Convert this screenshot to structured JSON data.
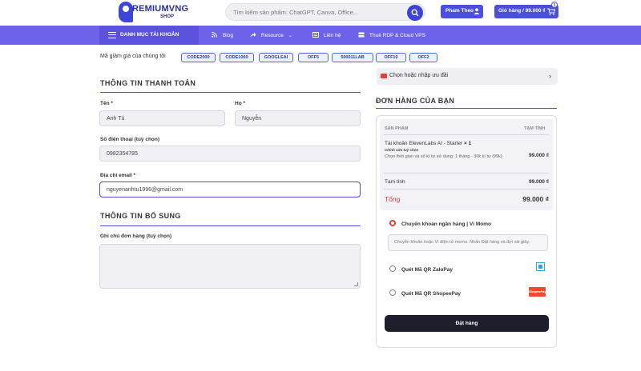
{
  "header": {
    "logo_main": "REMIUMVNG",
    "logo_sub": "SHOP",
    "search_placeholder": "Tìm kiếm sản phẩm: ChatGPT, Canva, Office...",
    "user_label": "Pham Theo",
    "cart_label": "Giỏ hàng / 99.000 ₫",
    "cart_count": "1",
    "accent": "#4b4fe0"
  },
  "nav": {
    "category_label": "DANH MỤC TÀI KHOẢN",
    "items": [
      {
        "label": "Blog",
        "icon": "rss-icon"
      },
      {
        "label": "Resource",
        "icon": "share-icon"
      },
      {
        "label": "Liên hệ",
        "icon": "contact-icon"
      },
      {
        "label": "Thuê RDP & Cloud VPS",
        "icon": "server-icon"
      }
    ]
  },
  "coupons": {
    "label": "Mã giảm giá của chúng tôi",
    "codes": [
      "CODE2000",
      "CODE1000",
      "GOOGLEAI",
      "OFF5",
      "500011LAB",
      "OFF10",
      "OFF2"
    ]
  },
  "billing": {
    "title": "THÔNG TIN THANH TOÁN",
    "first_name_label": "Tên *",
    "first_name_value": "Anh Tú",
    "last_name_label": "Họ *",
    "last_name_value": "Nguyễn",
    "phone_label": "Số điện thoại (tuỳ chọn)",
    "phone_value": "0982354785",
    "email_label": "Địa chỉ email *",
    "email_value": "nguyenanhtu1996@gmail.com"
  },
  "additional": {
    "title": "THÔNG TIN BỔ SUNG",
    "notes_label": "Ghi chú đơn hàng (tuỳ chọn)"
  },
  "order": {
    "promo_label": "Chọn hoặc nhập ưu đãi",
    "title": "ĐƠN HÀNG CỦA BẠN",
    "col_product": "SẢN PHẨM",
    "col_subtotal": "TẠM TÍNH",
    "product_name": "Tài khoản ElevenLabs AI - Starter",
    "product_qty": "× 1",
    "product_sub": "Chính sửa tuỳ chọn",
    "product_option": "Chọn thời gian và số kí tự sử dụng: 1 tháng - 30k kí tự (99k)",
    "product_price": "99.000 ₫",
    "subtotal_label": "Tạm tính",
    "subtotal_value": "99.000 ₫",
    "total_label": "Tổng",
    "total_value": "99.000 ₫",
    "payments": [
      {
        "label": "Chuyển khoản ngân hàng | Ví Momo",
        "selected": true
      },
      {
        "label": "Quét Mã QR ZaloPay",
        "selected": false
      },
      {
        "label": "Quét Mã QR ShopeePay",
        "selected": false
      }
    ],
    "payment_desc": "Chuyển khoản hoặc Ví điện tử momo. Nhấn Đặt hàng và đợi vài giây.",
    "shopee_badge": "ShopeePay",
    "place_order": "Đặt hàng"
  }
}
